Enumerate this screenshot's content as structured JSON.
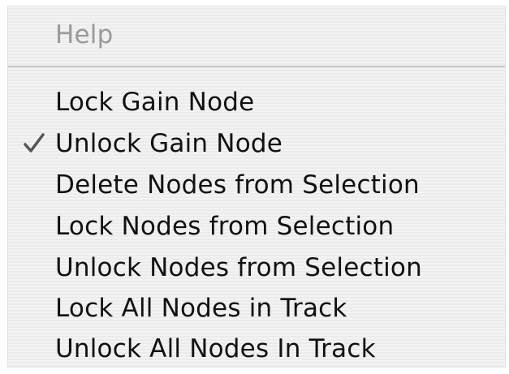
{
  "menu": {
    "items": [
      {
        "label": "Help",
        "enabled": false,
        "checked": false
      },
      {
        "label": "Lock Gain Node",
        "enabled": true,
        "checked": false
      },
      {
        "label": "Unlock Gain Node",
        "enabled": true,
        "checked": true
      },
      {
        "label": "Delete Nodes from Selection",
        "enabled": true,
        "checked": false
      },
      {
        "label": "Lock Nodes from Selection",
        "enabled": true,
        "checked": false
      },
      {
        "label": "Unlock Nodes from Selection",
        "enabled": true,
        "checked": false
      },
      {
        "label": "Lock All Nodes in Track",
        "enabled": true,
        "checked": false
      },
      {
        "label": "Unlock All Nodes In Track",
        "enabled": true,
        "checked": false
      }
    ]
  },
  "icons": {
    "checkmark": "checkmark-icon"
  },
  "colors": {
    "text": "#111111",
    "disabled_text": "#9a9a9a",
    "separator": "#c6c6c6"
  }
}
